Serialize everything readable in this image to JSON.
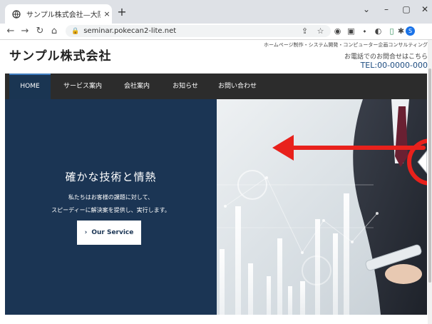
{
  "browser": {
    "tab_title": "サンプル株式会社—大阪府枚方市",
    "tab_close": "×",
    "new_tab": "+",
    "url": "seminar.pokecan2-lite.net",
    "profile_initial": "S"
  },
  "site": {
    "logo": "サンプル株式会社",
    "tagline": "ホームページ制作・システム開発・コンピューター企画コンサルティング",
    "contact_lead": "お電話でのお問合せはこちら",
    "tel": "TEL:00-0000-000"
  },
  "nav": {
    "items": [
      "HOME",
      "サービス案内",
      "会社案内",
      "お知らせ",
      "お問い合わせ"
    ],
    "active": "HOME"
  },
  "hero": {
    "title": "確かな技術と情熱",
    "desc_line1": "私たちはお客様の課題に対して、",
    "desc_line2": "スピーディーに解決案を提供し、実行します。",
    "button_label": "Our Service",
    "button_chevron": "›"
  },
  "annotation": {
    "arrow_color": "#e8211c"
  }
}
